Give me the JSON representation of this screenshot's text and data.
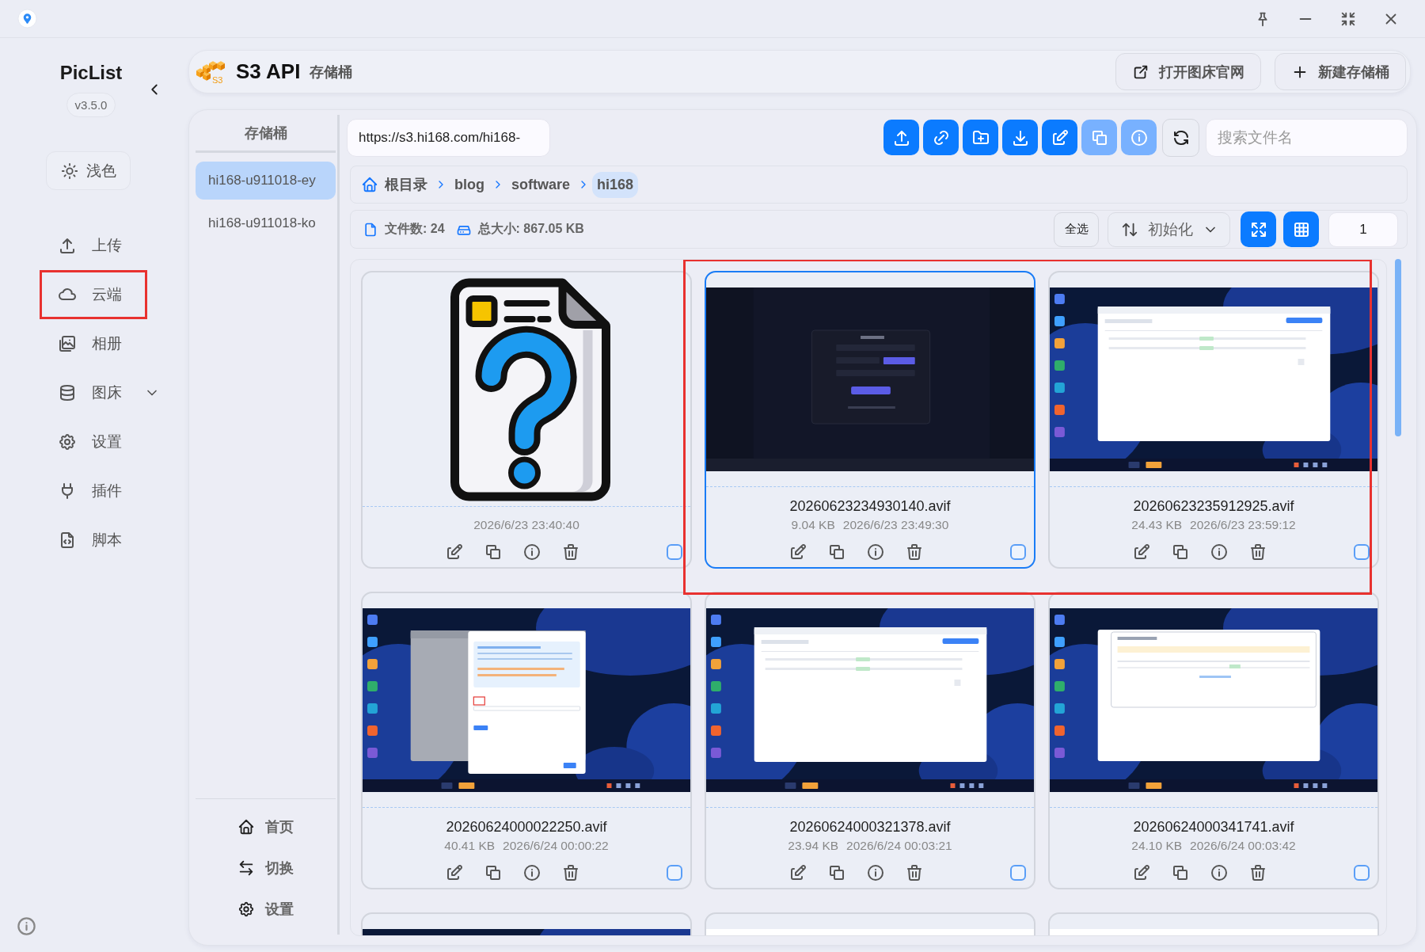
{
  "sidebar": {
    "app_name": "PicList",
    "version": "v3.5.0",
    "theme_button": "浅色",
    "nav": [
      {
        "label": "上传",
        "kind": "link",
        "annotated": false
      },
      {
        "label": "云端",
        "kind": "link",
        "annotated": true
      },
      {
        "label": "相册",
        "kind": "link",
        "annotated": false
      },
      {
        "label": "图床",
        "kind": "group",
        "expanded": false,
        "annotated": false
      },
      {
        "label": "设置",
        "kind": "link",
        "annotated": false
      },
      {
        "label": "插件",
        "kind": "link",
        "annotated": false
      },
      {
        "label": "脚本",
        "kind": "link",
        "annotated": false
      }
    ]
  },
  "header": {
    "logo_text": "S3",
    "title": "S3 API",
    "subtitle": "存储桶",
    "buttons": [
      {
        "label": "打开图床官网"
      },
      {
        "label": "新建存储桶"
      }
    ]
  },
  "buckets": {
    "title": "存储桶",
    "items": [
      {
        "name": "hi168-u911018-ey",
        "selected": true
      },
      {
        "name": "hi168-u911018-ko",
        "selected": false
      }
    ],
    "footer": [
      {
        "label": "首页"
      },
      {
        "label": "切换"
      },
      {
        "label": "设置"
      }
    ]
  },
  "toolbar": {
    "url": "https://s3.hi168.com/hi168-",
    "actions": [
      {
        "disabled": false
      },
      {
        "disabled": false
      },
      {
        "disabled": false
      },
      {
        "disabled": false
      },
      {
        "disabled": false
      },
      {
        "disabled": true
      },
      {
        "disabled": true
      }
    ],
    "search": {
      "placeholder": "搜索文件名"
    }
  },
  "breadcrumb": [
    {
      "label": "根目录",
      "current": false
    },
    {
      "label": "blog",
      "current": false
    },
    {
      "label": "software",
      "current": false
    },
    {
      "label": "hi168",
      "current": true
    }
  ],
  "summary": {
    "file_count": "文件数: 24",
    "total_size": "总大小: 867.05 KB",
    "select_all": "全选",
    "sort": "初始化",
    "page": "1"
  },
  "files": [
    {
      "kind": "unknown-file",
      "date": "2026/6/23 23:40:40",
      "selected": false,
      "checked": false,
      "annotated": false
    },
    {
      "kind": "login-page",
      "name": "20260623234930140.avif",
      "size": "9.04 KB",
      "date": "2026/6/23 23:49:30",
      "selected": true,
      "checked": false,
      "annotated": true
    },
    {
      "kind": "desktop-window",
      "name": "20260623235912925.avif",
      "size": "24.43 KB",
      "date": "2026/6/23 23:59:12",
      "selected": false,
      "checked": false,
      "annotated": true
    },
    {
      "kind": "desktop-dialog",
      "name": "20260624000022250.avif",
      "size": "40.41 KB",
      "date": "2026/6/24 00:00:22",
      "selected": false,
      "checked": false,
      "annotated": false
    },
    {
      "kind": "desktop-window",
      "name": "20260624000321378.avif",
      "size": "23.94 KB",
      "date": "2026/6/24 00:03:21",
      "selected": false,
      "checked": false,
      "annotated": false
    },
    {
      "kind": "desktop-popup",
      "name": "20260624000341741.avif",
      "size": "24.10 KB",
      "date": "2026/6/24 00:03:42",
      "selected": false,
      "checked": false,
      "annotated": false
    },
    {
      "kind": "desktop-dark",
      "selected": false,
      "annotated": false
    },
    {
      "kind": "app-window",
      "selected": false,
      "annotated": false
    },
    {
      "kind": "app-window",
      "selected": false,
      "annotated": false
    }
  ]
}
